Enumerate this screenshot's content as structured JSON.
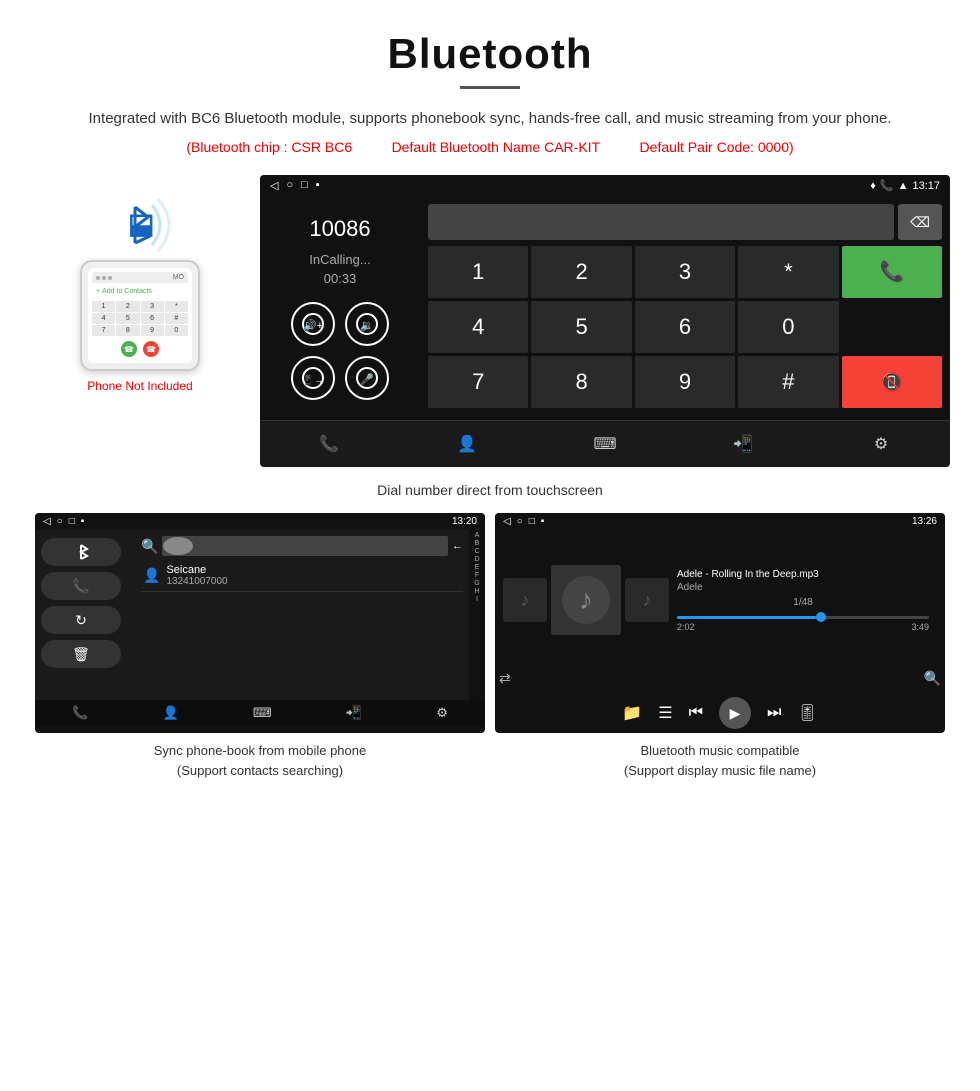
{
  "header": {
    "title": "Bluetooth",
    "subtitle": "Integrated with BC6 Bluetooth module, supports phonebook sync, hands-free call, and music streaming from your phone.",
    "chip_info": {
      "chip": "(Bluetooth chip : CSR BC6",
      "name": "Default Bluetooth Name CAR-KIT",
      "code": "Default Pair Code: 0000)"
    }
  },
  "phone_label": "Phone Not Included",
  "dial_screen": {
    "status_bar": {
      "left_icons": [
        "◁",
        "○",
        "□",
        "▪"
      ],
      "right": "13:17"
    },
    "number": "10086",
    "calling_status": "InCalling...",
    "timer": "00:33",
    "numpad": [
      "1",
      "2",
      "3",
      "*",
      "4",
      "5",
      "6",
      "0",
      "7",
      "8",
      "9",
      "#"
    ],
    "caption": "Dial number direct from touchscreen"
  },
  "phonebook_screen": {
    "status_bar_right": "13:20",
    "contact_name": "Seicane",
    "contact_number": "13241007000",
    "alpha_list": [
      "A",
      "B",
      "C",
      "D",
      "E",
      "F",
      "G",
      "H",
      "I"
    ],
    "caption_line1": "Sync phone-book from mobile phone",
    "caption_line2": "(Support contacts searching)"
  },
  "music_screen": {
    "status_bar_right": "13:26",
    "song_title": "Adele - Rolling In the Deep.mp3",
    "artist": "Adele",
    "counter": "1/48",
    "time_current": "2:02",
    "time_total": "3:49",
    "progress_percent": 55,
    "caption_line1": "Bluetooth music compatible",
    "caption_line2": "(Support display music file name)"
  }
}
